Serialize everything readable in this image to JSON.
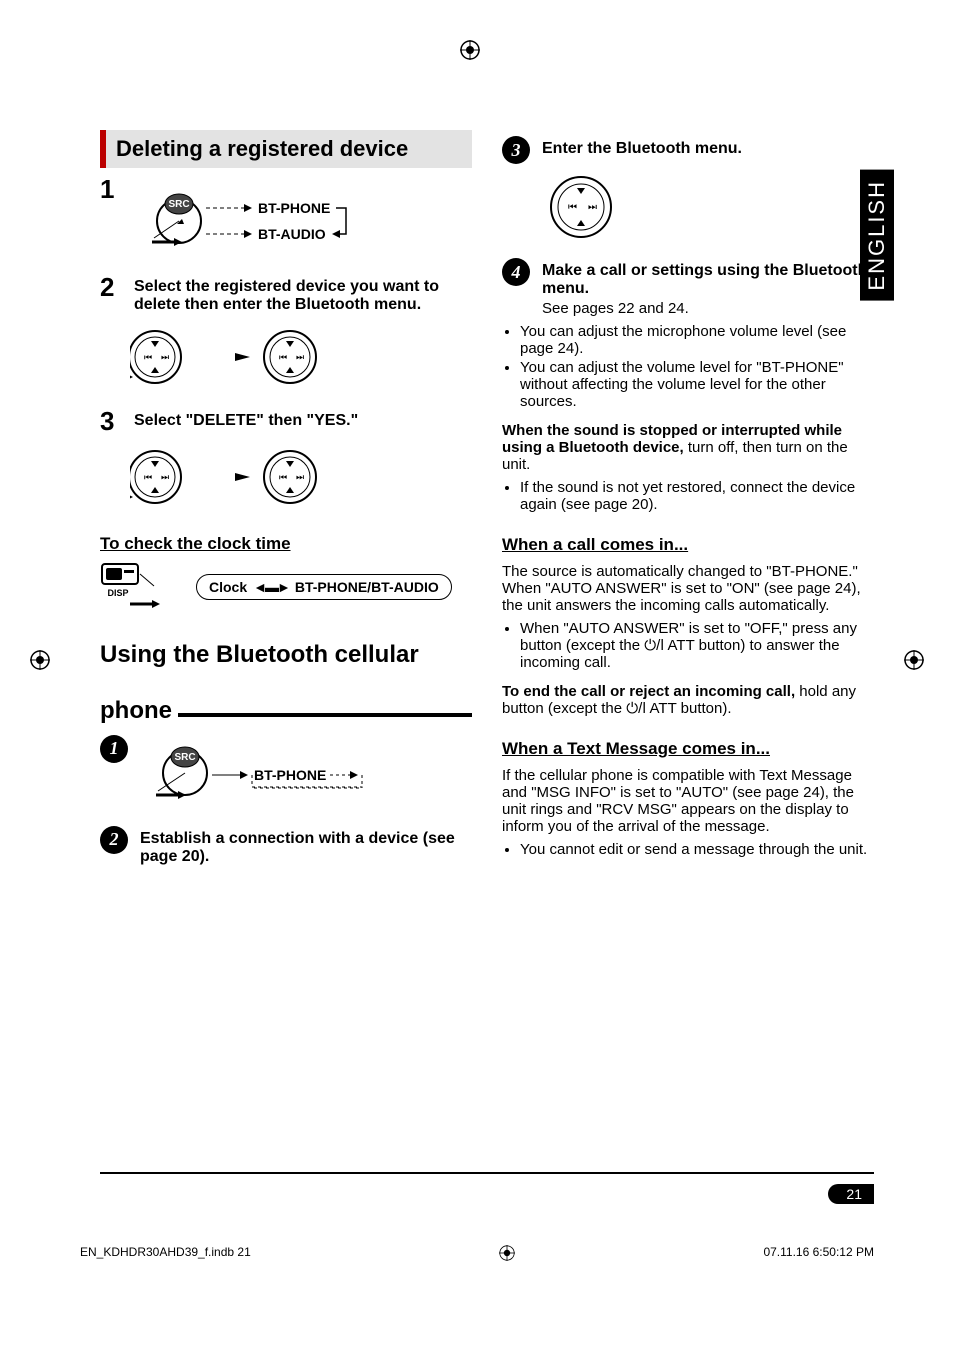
{
  "language_tab": "ENGLISH",
  "left_col": {
    "section_title": "Deleting a registered device",
    "step1_num": "1",
    "step1_labels": {
      "src": "SRC",
      "phone": "BT-PHONE",
      "audio": "BT-AUDIO"
    },
    "step2_num": "2",
    "step2_text": "Select the registered device you want to delete then enter the Bluetooth menu.",
    "step3_num": "3",
    "step3_text": "Select \"DELETE\" then \"YES.\"",
    "clock_heading": "To check the clock time",
    "clock_pill_left": "Clock",
    "clock_pill_right": "BT-PHONE/BT-AUDIO",
    "disp_label": "DISP",
    "big_heading_line1": "Using the Bluetooth cellular",
    "big_heading_line2": "phone",
    "cstep1_num": "1",
    "cstep1_labels": {
      "src": "SRC",
      "phone": "BT-PHONE"
    },
    "cstep2_num": "2",
    "cstep2_text": "Establish a connection with a device (see page 20)."
  },
  "right_col": {
    "cstep3_num": "3",
    "cstep3_text": "Enter the Bluetooth menu.",
    "cstep4_num": "4",
    "cstep4_text": "Make a call or settings using the Bluetooth menu.",
    "cstep4_sub": "See pages 22 and 24.",
    "bullets_a": [
      "You can adjust the microphone volume level (see page 24).",
      "You can adjust the volume level for \"BT-PHONE\" without affecting the volume level for the other sources."
    ],
    "interrupt_bold": "When the sound is stopped or interrupted while using a Bluetooth device,",
    "interrupt_rest": " turn off, then turn on the unit.",
    "interrupt_bullet": "If the sound is not yet restored, connect the device again (see page 20).",
    "call_heading": "When a call comes in...",
    "call_p1": "The source is automatically changed to \"BT-PHONE.\" When \"AUTO ANSWER\" is set to \"ON\" (see page 24), the unit answers the incoming calls automatically.",
    "call_bullet_pre": "When \"AUTO ANSWER\" is set to \"OFF,\" press any button (except the ",
    "call_bullet_mid": " ATT",
    "call_bullet_post": " button) to answer the incoming call.",
    "end_bold": "To end the call or reject an incoming call,",
    "end_rest_pre": " hold any button (except the ",
    "end_rest_mid": " ATT",
    "end_rest_post": " button).",
    "text_heading": "When a Text Message comes in...",
    "text_p1": "If the cellular phone is compatible with Text Message and \"MSG INFO\" is set to \"AUTO\" (see page 24), the unit rings and \"RCV MSG\" appears on the display to inform you of the arrival of the message.",
    "text_bullet": "You cannot edit or send a message through the unit."
  },
  "page_number": "21",
  "footer_left": "EN_KDHDR30AHD39_f.indb   21",
  "footer_right": "07.11.16   6:50:12 PM"
}
